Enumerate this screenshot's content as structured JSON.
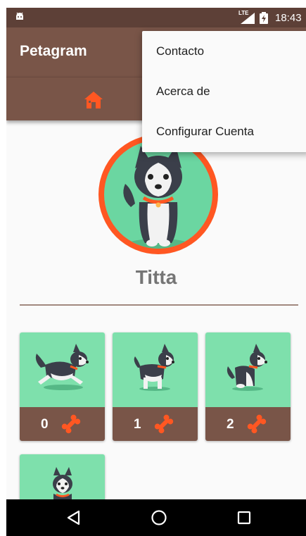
{
  "status_bar": {
    "time": "18:43",
    "network": "LTE",
    "icons": [
      "android-icon",
      "signal-icon",
      "battery-icon"
    ]
  },
  "app_bar": {
    "title": "Petagram"
  },
  "tabs": [
    {
      "icon": "home-icon",
      "active": true
    }
  ],
  "menu": {
    "items": [
      "Contacto",
      "Acerca de",
      "Configurar Cuenta"
    ]
  },
  "profile": {
    "name": "Titta"
  },
  "grid": [
    {
      "likes": "0",
      "icon": "bone-icon"
    },
    {
      "likes": "1",
      "icon": "bone-icon"
    },
    {
      "likes": "2",
      "icon": "bone-icon"
    },
    {
      "likes": "",
      "icon": "bone-icon"
    }
  ],
  "colors": {
    "primary": "#795548",
    "primary_dark": "#5d4037",
    "accent": "#ff5722",
    "photo_background": "#7ee0ac",
    "text_secondary": "#757575"
  },
  "nav_bar": [
    "back-icon",
    "home-circle-icon",
    "recents-icon"
  ]
}
